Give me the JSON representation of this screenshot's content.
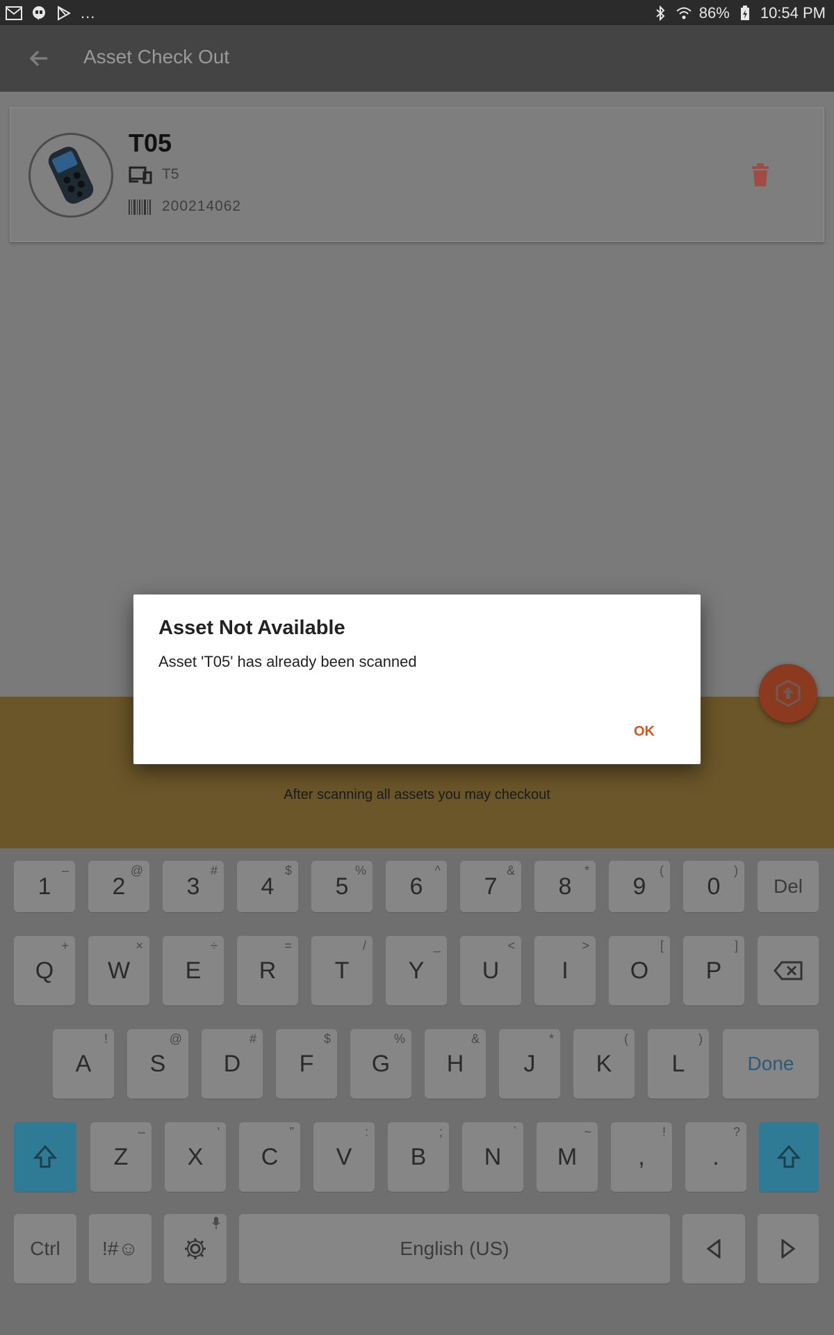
{
  "status_bar": {
    "overflow": "...",
    "battery": "86%",
    "time": "10:54 PM"
  },
  "app_bar": {
    "title": "Asset Check Out"
  },
  "asset": {
    "name": "T05",
    "model": "T5",
    "barcode": "200214062"
  },
  "banner": {
    "hint": "After scanning all assets you may checkout"
  },
  "dialog": {
    "title": "Asset Not Available",
    "message": "Asset 'T05' has already been scanned",
    "ok_label": "OK"
  },
  "keyboard": {
    "row1": [
      {
        "k": "1",
        "s": "–"
      },
      {
        "k": "2",
        "s": "@"
      },
      {
        "k": "3",
        "s": "#"
      },
      {
        "k": "4",
        "s": "$"
      },
      {
        "k": "5",
        "s": "%"
      },
      {
        "k": "6",
        "s": "^"
      },
      {
        "k": "7",
        "s": "&"
      },
      {
        "k": "8",
        "s": "*"
      },
      {
        "k": "9",
        "s": "("
      },
      {
        "k": "0",
        "s": ")"
      }
    ],
    "del_label": "Del",
    "row2": [
      {
        "k": "Q",
        "s": "+"
      },
      {
        "k": "W",
        "s": "×"
      },
      {
        "k": "E",
        "s": "÷"
      },
      {
        "k": "R",
        "s": "="
      },
      {
        "k": "T",
        "s": "/"
      },
      {
        "k": "Y",
        "s": "_"
      },
      {
        "k": "U",
        "s": "<"
      },
      {
        "k": "I",
        "s": ">"
      },
      {
        "k": "O",
        "s": "["
      },
      {
        "k": "P",
        "s": "]"
      }
    ],
    "row3": [
      {
        "k": "A",
        "s": "!"
      },
      {
        "k": "S",
        "s": "@"
      },
      {
        "k": "D",
        "s": "#"
      },
      {
        "k": "F",
        "s": "$"
      },
      {
        "k": "G",
        "s": "%"
      },
      {
        "k": "H",
        "s": "&"
      },
      {
        "k": "J",
        "s": "*"
      },
      {
        "k": "K",
        "s": "("
      },
      {
        "k": "L",
        "s": ")"
      }
    ],
    "done_label": "Done",
    "row4": [
      {
        "k": "Z",
        "s": "–"
      },
      {
        "k": "X",
        "s": "'"
      },
      {
        "k": "C",
        "s": "\""
      },
      {
        "k": "V",
        "s": ":"
      },
      {
        "k": "B",
        "s": ";"
      },
      {
        "k": "N",
        "s": "`"
      },
      {
        "k": "M",
        "s": "~"
      },
      {
        "k": ",",
        "s": "!"
      },
      {
        "k": ".",
        "s": "?"
      }
    ],
    "ctrl_label": "Ctrl",
    "symbols_label": "!#☺",
    "space_label": "English (US)"
  },
  "icons": {
    "back": "back-arrow-icon",
    "model": "devices-icon",
    "barcode": "barcode-icon",
    "delete": "trash-icon",
    "fab": "upload-hexagon-icon"
  },
  "colors": {
    "accent": "#e2521f",
    "banner": "#6b5629",
    "shift_key": "#2f7a94",
    "delete": "#a34a45"
  }
}
